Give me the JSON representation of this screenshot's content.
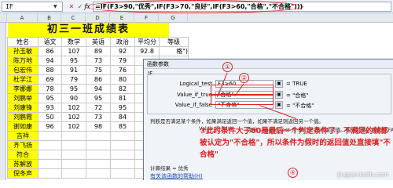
{
  "name_box": "IF",
  "formula_bar": {
    "cancel": "✕",
    "confirm": "✓",
    "fx": "fx",
    "formula": "=IF(F3>90,\"优秀\",IF(F3>70,\"良好\",IF(F3>60,\"合格\",\"不合格\")))"
  },
  "columns": [
    "A",
    "B",
    "C",
    "D",
    "E",
    "F",
    "G"
  ],
  "sheet": {
    "title": "初三一班成绩表",
    "headers": [
      "姓名",
      "语文",
      "数学",
      "英语",
      "政治",
      "平均分",
      "等级"
    ],
    "rows": [
      [
        "孙玉敏",
        "86",
        "107",
        "89",
        "92",
        "92.8",
        "格\")"
      ],
      [
        "陈万地",
        "94",
        "95",
        "73",
        "79",
        "",
        ""
      ],
      [
        "包宏伟",
        "88",
        "91",
        "75",
        "76",
        "",
        ""
      ],
      [
        "杜学江",
        "69",
        "79",
        "86",
        "80",
        "",
        ""
      ],
      [
        "李娜娜",
        "78",
        "95",
        "94",
        "82",
        "",
        ""
      ],
      [
        "刘鹏举",
        "95",
        "90",
        "95",
        "81",
        "",
        ""
      ],
      [
        "刘康锋",
        "93",
        "102",
        "72",
        "95",
        "",
        ""
      ],
      [
        "刘鹏霞",
        "50",
        "102",
        "73",
        "84",
        "",
        ""
      ],
      [
        "谢如康",
        "96",
        "102",
        "98",
        "85",
        "",
        ""
      ],
      [
        "吉祥",
        "",
        "",
        "",
        "",
        "",
        ""
      ],
      [
        "齐飞扬",
        "",
        "",
        "",
        "",
        "",
        ""
      ],
      [
        "符合",
        "",
        "",
        "",
        "",
        "",
        ""
      ],
      [
        "苏解放",
        "",
        "",
        "",
        "",
        "",
        ""
      ],
      [
        "倪冬声",
        "",
        "",
        "",
        "",
        "",
        ""
      ]
    ]
  },
  "dialog": {
    "title": "函数参数",
    "function_name": "IF",
    "args": [
      {
        "label": "Logical_test",
        "value": "F3>60",
        "result": "= TRUE"
      },
      {
        "label": "Value_if_true",
        "value": "\"合格\"",
        "result": "= \"合格\""
      },
      {
        "label": "Value_if_false",
        "value": "\"不合格\"",
        "result": "= \"不合格\""
      }
    ],
    "description": "判断是否满足某个条件，如果满足返回一个值，如果不满足则返回另一个值。",
    "arg_help_label": "Value_if_false",
    "arg_help": "是当 Logical_test 为 FALSE 时的返回值。如果忽略，则返回 FALSE",
    "calc_result": "计算结果 = 优秀",
    "help_link": "有关该函数的帮助(H)"
  },
  "annotations": {
    "n1": "①",
    "n2": "②",
    "n3": "③",
    "n4": "④",
    "text": "③此时条件大于60是最后一个判定条件了，不满足的就都被认定为\"不合格\"，所以条件为假时的返回值处直接填\"不合格\"",
    "color": "#e02020"
  },
  "watermark": "jingyan.baidu.com"
}
